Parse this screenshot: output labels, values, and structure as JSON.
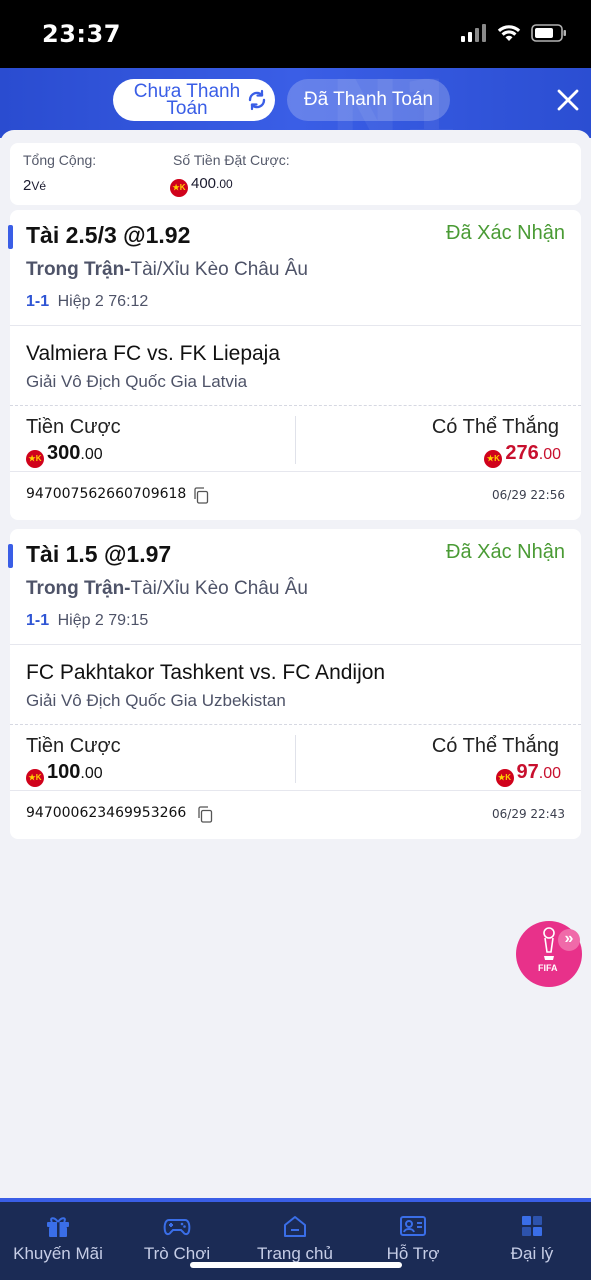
{
  "status_bar": {
    "time": "23:37"
  },
  "header": {
    "tab_unpaid": "Chưa Thanh Toán",
    "tab_paid": "Đã Thanh Toán"
  },
  "summary": {
    "total_label": "Tổng Cộng:",
    "total_count": "2",
    "total_unit": "Vé",
    "stake_label": "Số Tiền Đặt Cược:",
    "stake_int": "400",
    "stake_dec": ".00"
  },
  "bets": [
    {
      "title": "Tài 2.5/3 @1.92",
      "status": "Đã Xác Nhận",
      "type_bold": "Trong Trận-",
      "type_rest": "Tài/Xỉu Kèo Châu Âu",
      "score": "1-1",
      "period": "Hiệp 2",
      "clock": "76:12",
      "match": "Valmiera FC vs. FK Liepaja",
      "league": "Giải Vô Địch Quốc Gia Latvia",
      "stake_label": "Tiền Cược",
      "stake_int": "300",
      "stake_dec": ".00",
      "win_label": "Có Thể Thắng",
      "win_int": "276",
      "win_dec": ".00",
      "ticket_id": "947007562660709618",
      "time": "06/29 22:56"
    },
    {
      "title": "Tài 1.5 @1.97",
      "status": "Đã Xác Nhận",
      "type_bold": "Trong Trận-",
      "type_rest": "Tài/Xỉu Kèo Châu Âu",
      "score": "1-1",
      "period": "Hiệp 2",
      "clock": "79:15",
      "match": "FC Pakhtakor Tashkent vs. FC Andijon",
      "league": "Giải Vô Địch Quốc Gia Uzbekistan",
      "stake_label": "Tiền Cược",
      "stake_int": "100",
      "stake_dec": ".00",
      "win_label": "Có Thể Thắng",
      "win_int": "97",
      "win_dec": ".00",
      "ticket_id": "947000623469953266",
      "time": "06/29 22:43"
    }
  ],
  "currency_badge": "★K",
  "fifa": {
    "label": "FIFA"
  },
  "nav": [
    {
      "label": "Khuyến Mãi",
      "icon": "gift-icon"
    },
    {
      "label": "Trò Chơi",
      "icon": "gamepad-icon"
    },
    {
      "label": "Trang chủ",
      "icon": "home-icon"
    },
    {
      "label": "Hỗ Trợ",
      "icon": "support-icon"
    },
    {
      "label": "Đại lý",
      "icon": "agent-icon"
    }
  ],
  "colors": {
    "accent": "#3a5ee6",
    "confirmed": "#4a9b35",
    "win": "#c8102e",
    "nav_bg": "#1b2b55"
  }
}
